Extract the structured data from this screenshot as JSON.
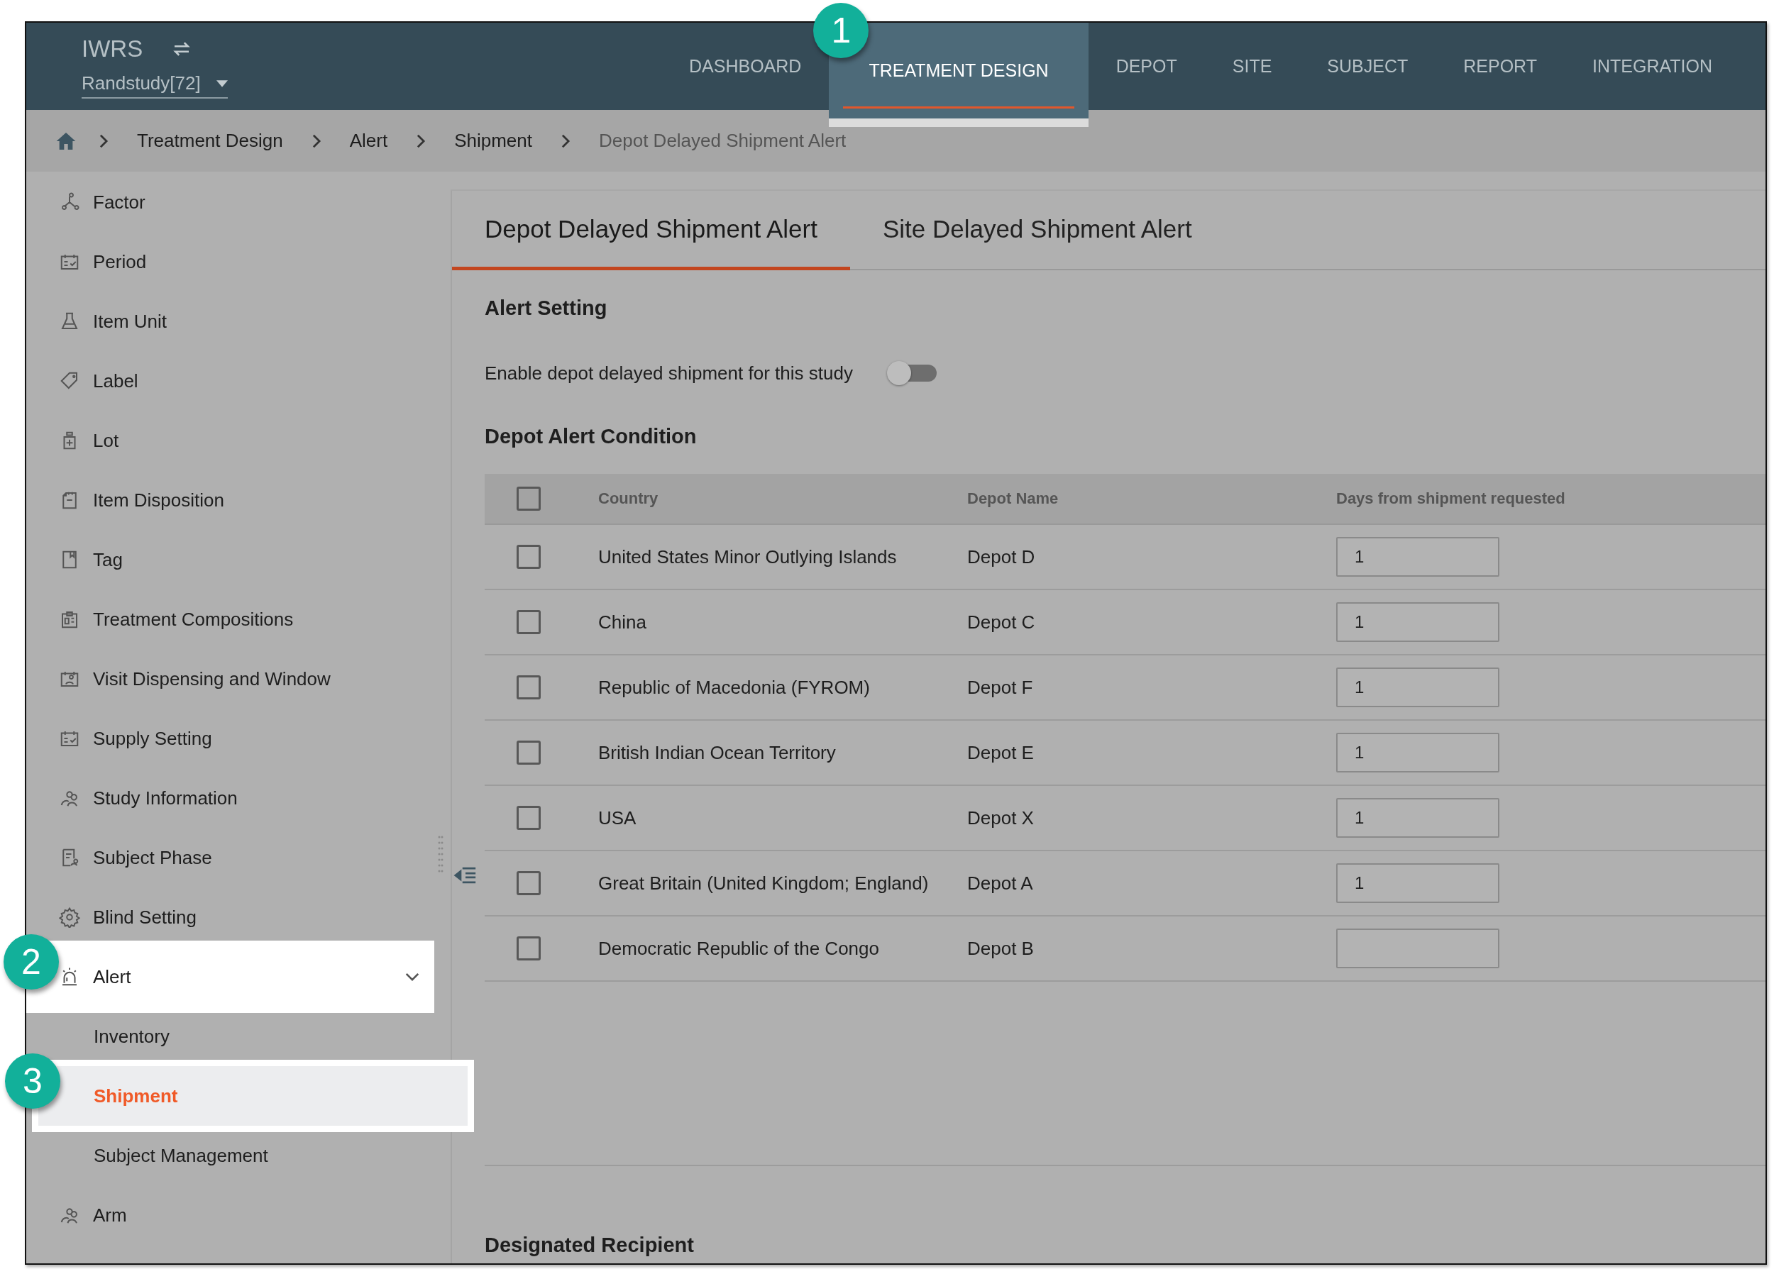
{
  "header": {
    "app_name": "IWRS",
    "study": "Randstudy[72]"
  },
  "nav": [
    {
      "label": "DASHBOARD",
      "selected": false
    },
    {
      "label": "TREATMENT DESIGN",
      "selected": true,
      "callout": "1"
    },
    {
      "label": "DEPOT",
      "selected": false
    },
    {
      "label": "SITE",
      "selected": false
    },
    {
      "label": "SUBJECT",
      "selected": false
    },
    {
      "label": "REPORT",
      "selected": false
    },
    {
      "label": "INTEGRATION",
      "selected": false
    }
  ],
  "breadcrumb": [
    "Treatment Design",
    "Alert",
    "Shipment",
    "Depot Delayed Shipment Alert"
  ],
  "sidebar": {
    "items": [
      {
        "label": "Factor",
        "selected": false
      },
      {
        "label": "Period",
        "selected": false
      },
      {
        "label": "Item Unit",
        "selected": false
      },
      {
        "label": "Label",
        "selected": false
      },
      {
        "label": "Lot",
        "selected": false
      },
      {
        "label": "Item Disposition",
        "selected": false
      },
      {
        "label": "Tag",
        "selected": false
      },
      {
        "label": "Treatment Compositions",
        "selected": false
      },
      {
        "label": "Visit Dispensing and Window",
        "selected": false
      },
      {
        "label": "Supply Setting",
        "selected": false
      },
      {
        "label": "Study Information",
        "selected": false
      },
      {
        "label": "Subject Phase",
        "selected": false
      },
      {
        "label": "Blind Setting",
        "selected": false
      },
      {
        "label": "Alert",
        "selected": false,
        "expanded": true,
        "callout": "2",
        "children": [
          {
            "label": "Inventory",
            "selected": false
          },
          {
            "label": "Shipment",
            "selected": true,
            "callout": "3"
          },
          {
            "label": "Subject Management",
            "selected": false
          }
        ]
      },
      {
        "label": "Arm",
        "selected": false
      }
    ]
  },
  "tabs": [
    {
      "label": "Depot Delayed Shipment Alert",
      "selected": true
    },
    {
      "label": "Site Delayed Shipment Alert",
      "selected": false
    }
  ],
  "alert_setting": {
    "title": "Alert Setting",
    "toggle_label": "Enable depot delayed shipment for this study",
    "on": false
  },
  "condition": {
    "title": "Depot Alert Condition",
    "all_checked": false,
    "columns": [
      "Country",
      "Depot Name",
      "Days from shipment requested"
    ],
    "rows": [
      {
        "country": "United States Minor Outlying Islands",
        "depot": "Depot D",
        "days": "1",
        "checked": false
      },
      {
        "country": "China",
        "depot": "Depot C",
        "days": "1",
        "checked": false
      },
      {
        "country": "Republic of Macedonia (FYROM)",
        "depot": "Depot F",
        "days": "1",
        "checked": false
      },
      {
        "country": "British Indian Ocean Territory",
        "depot": "Depot E",
        "days": "1",
        "checked": false
      },
      {
        "country": "USA",
        "depot": "Depot X",
        "days": "1",
        "checked": false
      },
      {
        "country": "Great Britain (United Kingdom; England)",
        "depot": "Depot A",
        "days": "1",
        "checked": false
      },
      {
        "country": "Democratic Republic of the Congo",
        "depot": "Depot B",
        "checked": false
      }
    ]
  },
  "recipient": {
    "title": "Designated Recipient"
  }
}
